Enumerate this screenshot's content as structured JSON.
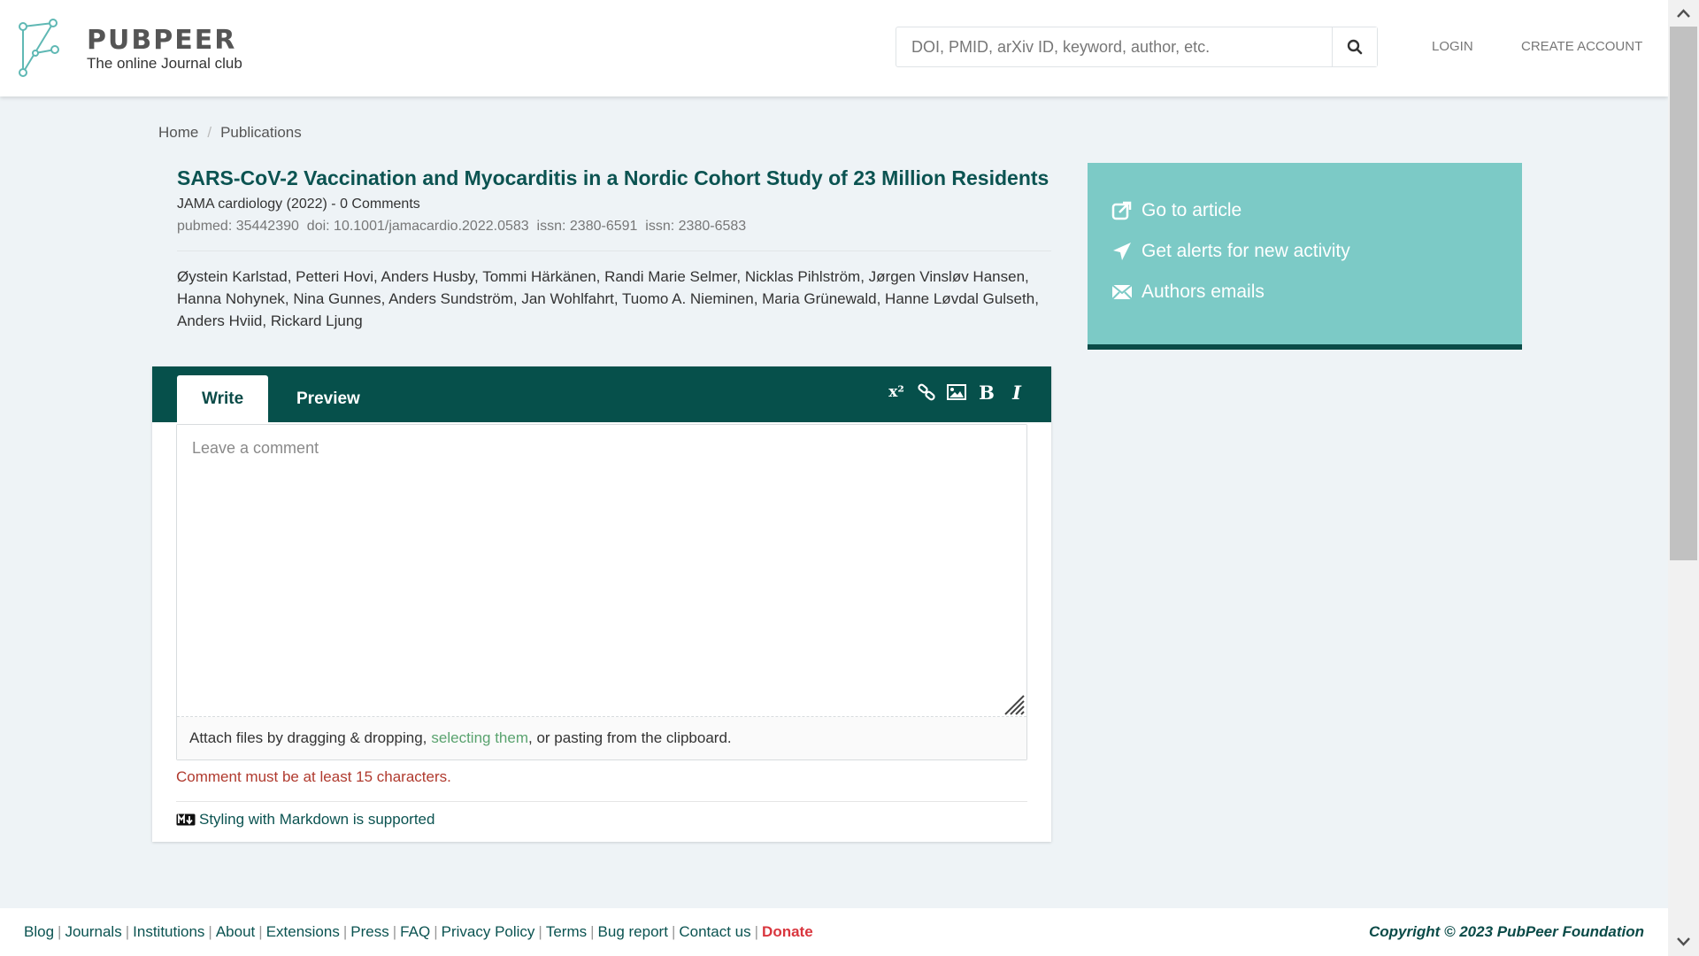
{
  "brand": {
    "name": "PUBPEER",
    "tagline": "The online Journal club"
  },
  "search": {
    "placeholder": "DOI, PMID, arXiv ID, keyword, author, etc.",
    "value": ""
  },
  "nav": {
    "login": "LOGIN",
    "create_account": "CREATE ACCOUNT"
  },
  "breadcrumb": {
    "items": [
      "Home",
      "Publications"
    ],
    "separator": "/"
  },
  "article": {
    "title": "SARS-CoV-2 Vaccination and Myocarditis in a Nordic Cohort Study of 23 Million Residents",
    "journal_line": "JAMA cardiology (2022) - 0 Comments",
    "ids": {
      "pubmed": "pubmed: 35442390",
      "doi": "doi: 10.1001/jamacardio.2022.0583",
      "issn1": "issn: 2380-6591",
      "issn2": "issn: 2380-6583"
    },
    "authors": "Øystein Karlstad, Petteri Hovi, Anders Husby, Tommi Härkänen, Randi Marie Selmer, Nicklas Pihlström, Jørgen Vinsløv Hansen, Hanna Nohynek, Nina Gunnes, Anders Sundström, Jan Wohlfahrt, Tuomo A. Nieminen, Maria Grünewald, Hanne Løvdal Gulseth, Anders Hviid, Rickard Ljung"
  },
  "sidebar": {
    "items": [
      {
        "label": "Go to article",
        "icon": "external-link-icon"
      },
      {
        "label": "Get alerts for new activity",
        "icon": "paper-plane-icon"
      },
      {
        "label": "Authors emails",
        "icon": "envelope-icon"
      }
    ]
  },
  "editor": {
    "tabs": {
      "write": "Write",
      "preview": "Preview"
    },
    "tools": {
      "superscript": "x²",
      "bold": "B",
      "italic": "I"
    },
    "placeholder": "Leave a comment",
    "value": "",
    "attach": {
      "before": "Attach files by dragging & dropping,",
      "link": "selecting them",
      "after": ", or pasting from the clipboard."
    },
    "validation": "Comment must be at least 15 characters.",
    "markdown": "Styling with Markdown is supported"
  },
  "footer": {
    "links": [
      "Blog",
      "Journals",
      "Institutions",
      "About",
      "Extensions",
      "Press",
      "FAQ",
      "Privacy Policy",
      "Terms",
      "Bug report",
      "Contact us"
    ],
    "donate": "Donate",
    "copyright": "Copyright © 2023 PubPeer Foundation"
  },
  "colors": {
    "brand_dark": "#0b4b48",
    "toolbar": "#06504b",
    "sidebar": "#7ccac6",
    "link_green": "#5aa36f",
    "error": "#b03a2e",
    "donate": "#d9363e"
  }
}
